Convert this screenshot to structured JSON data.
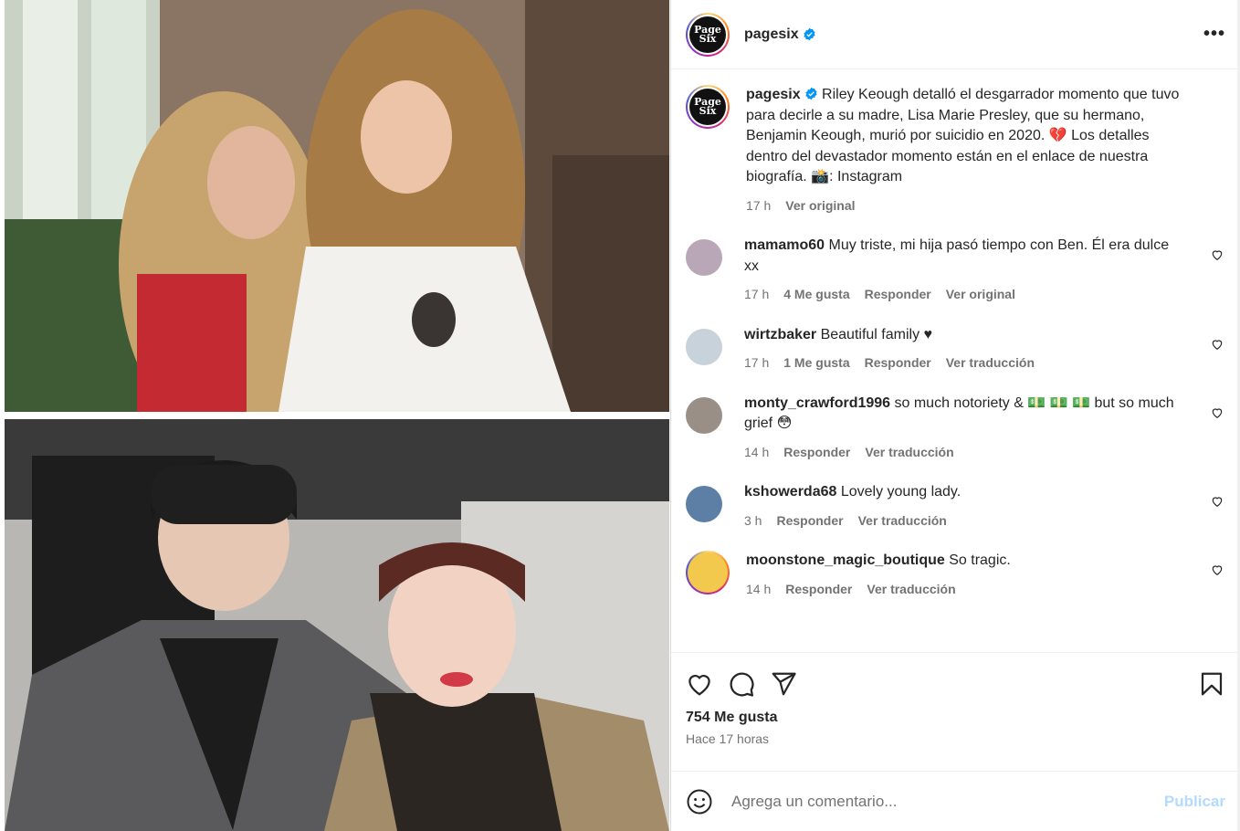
{
  "post": {
    "username": "pagesix",
    "verified": true,
    "logo_text_top": "Page",
    "logo_text_bottom": "Six",
    "more_label": "•••"
  },
  "caption": {
    "username": "pagesix",
    "text": " Riley Keough detalló el desgarrador momento que tuvo para decirle a su madre, Lisa Marie Presley, que su hermano, Benjamin Keough, murió por suicidio en 2020. 💔  Los detalles dentro del devastador momento están en el enlace de nuestra biografía. 📸: Instagram",
    "time": "17 h",
    "see_original": "Ver original"
  },
  "comments": [
    {
      "username": "mamamo60",
      "text": " Muy triste, mi hija pasó tiempo con Ben. Él era dulce xx",
      "time": "17 h",
      "likes": "4 Me gusta",
      "reply": "Responder",
      "translate": "Ver original",
      "avatar_color": "#b9a7b8"
    },
    {
      "username": "wirtzbaker",
      "text": " Beautiful family ♥",
      "time": "17 h",
      "likes": "1 Me gusta",
      "reply": "Responder",
      "translate": "Ver traducción",
      "avatar_color": "#c7d2da"
    },
    {
      "username": "monty_crawford1996",
      "text": " so much notoriety & 💵 💵 💵  but so much grief 😳",
      "time": "14 h",
      "likes": "",
      "reply": "Responder",
      "translate": "Ver traducción",
      "avatar_color": "#9a8f86"
    },
    {
      "username": "kshowerda68",
      "text": " Lovely young lady.",
      "time": "3 h",
      "likes": "",
      "reply": "Responder",
      "translate": "Ver traducción",
      "avatar_color": "#5d7fa6"
    },
    {
      "username": "moonstone_magic_boutique",
      "text": " So tragic.",
      "time": "14 h",
      "likes": "",
      "reply": "Responder",
      "translate": "Ver traducción",
      "avatar_color": "#f2c94c"
    }
  ],
  "stats": {
    "likes": "754 Me gusta",
    "time_ago": "Hace 17 horas"
  },
  "composer": {
    "placeholder": "Agrega un comentario...",
    "publish": "Publicar"
  },
  "icons": {
    "heart": "heart-icon",
    "comment": "comment-icon",
    "share": "share-icon",
    "bookmark": "bookmark-icon",
    "emoji": "emoji-icon",
    "verified": "verified-badge-icon",
    "more": "more-options-icon"
  },
  "colors": {
    "verified_blue": "#0095f6",
    "publish_disabled": "#b3dbff",
    "meta_gray": "#737373"
  }
}
